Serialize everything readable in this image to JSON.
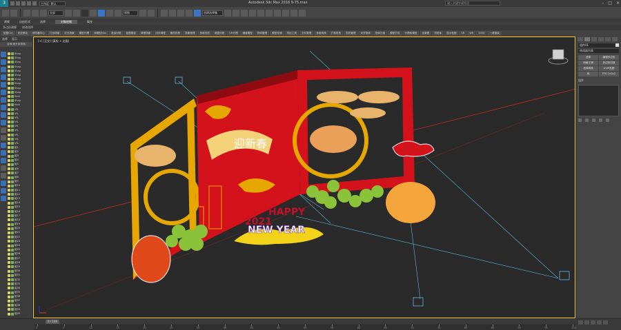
{
  "titlebar": {
    "workspace": "工作区: 默认",
    "title": "Autodesk 3ds Max 2016    9-75.max",
    "search_placeholder": "键入关键字或短语"
  },
  "toolbar": {
    "selection_filter": "全部",
    "ref_coord": "视图",
    "named_sets": "创建选择集"
  },
  "ribbon": {
    "tabs": [
      "建模",
      "自由形式",
      "选择",
      "对象绘制",
      "填充"
    ],
    "active_tab": "对象绘制",
    "sub_tabs": [
      "多边形建模",
      "修改选择"
    ],
    "plugins": [
      "贴图Ctrl",
      "安全移动",
      "修改器中心",
      "打包场景",
      "灯光场景",
      "模型代理",
      "转模型Max",
      "批量材质",
      "贴图路径",
      "清理场景",
      "内存清理",
      "随机材质",
      "场景管理",
      "多维材质",
      "修复材质",
      "VR代理",
      "通道模型",
      "物体管理",
      "模型检测",
      "导出工具",
      "文件整理",
      "多维转换",
      "扩展材质",
      "材质管理",
      "对齐物体",
      "物体打组",
      "模型打包",
      "代理转模型",
      "全景图",
      "材质库",
      "显示贴图",
      "SR",
      "WR",
      "1000",
      "一键渲染"
    ]
  },
  "explorer": {
    "menu": [
      "选择",
      "显示"
    ],
    "header": "名称(按升序排序)",
    "rows": [
      "Shap",
      "Shap",
      "Shap",
      "Shap",
      "Shap",
      "Shap",
      "Shap",
      "Shap",
      "Shap",
      "Shap",
      "Sect",
      "Shap",
      "Sect",
      "VR-",
      "VR-",
      "VR-",
      "VR-",
      "VR-",
      "VR-",
      "VR-",
      "VR-",
      "VR-",
      "组1",
      "组2",
      "组3",
      "组4",
      "组5",
      "组6",
      "组7",
      "组8",
      "组9",
      "组10",
      "组11",
      "组12",
      "组13",
      "组14",
      "组15",
      "组16",
      "组17",
      "组18",
      "组19",
      "组20",
      "组21",
      "组22",
      "组23",
      "组24",
      "组25",
      "组26",
      "组27",
      "组28",
      "组29",
      "组30",
      "组31",
      "组32",
      "组33",
      "组34",
      "组35",
      "组36",
      "组37",
      "组38",
      "组39",
      "组40"
    ]
  },
  "viewport": {
    "label": "[+] [正交] [真实 + 边面]",
    "scene_text": {
      "banner": "迎新春",
      "year": "2021",
      "happy": "HAPPY",
      "new_year": "NEW YEAR"
    }
  },
  "command_panel": {
    "object_name": "组件01",
    "modifier_list": "修改器列表",
    "buttons": [
      "选择",
      "编辑多边形",
      "网格平滑",
      "多边形切换",
      "选择转换",
      "UVW贴图",
      "壳",
      "FFD 2x2x2"
    ],
    "stack_label": "组件"
  },
  "timeline": {
    "frame": "0 / 100",
    "ticks": [
      "0",
      "5",
      "10",
      "15",
      "20",
      "25",
      "30",
      "35",
      "40",
      "45",
      "50",
      "55",
      "60",
      "65",
      "70",
      "75",
      "80",
      "85",
      "90",
      "95",
      "100"
    ]
  },
  "colors": {
    "viewport_bg": "#2a2a2a",
    "selection_border": "#ffcc33",
    "red": "#d4121b",
    "gold": "#e6a700"
  }
}
